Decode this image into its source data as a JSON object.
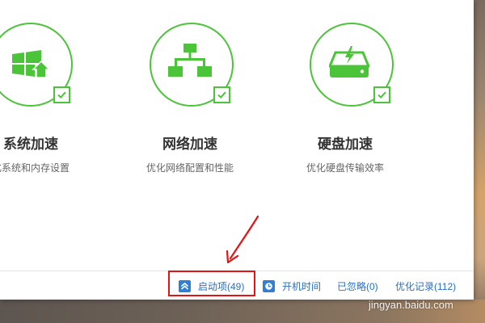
{
  "features": [
    {
      "title": "系统加速",
      "desc": "化系统和内存设置",
      "icon": "windows-boost-icon"
    },
    {
      "title": "网络加速",
      "desc": "优化网络配置和性能",
      "icon": "network-tree-icon"
    },
    {
      "title": "硬盘加速",
      "desc": "优化硬盘传输效率",
      "icon": "hard-disk-icon"
    }
  ],
  "status_bar": {
    "startup_label": "启动项(49)",
    "boot_time_label": "开机时间",
    "ignored_label": "已忽略(0)",
    "history_label": "优化记录(112)"
  },
  "watermark": "jingyan.baidu.com",
  "colors": {
    "accent_green": "#4cc43a",
    "link_blue": "#2a6fc4",
    "highlight_red": "#e01515"
  }
}
